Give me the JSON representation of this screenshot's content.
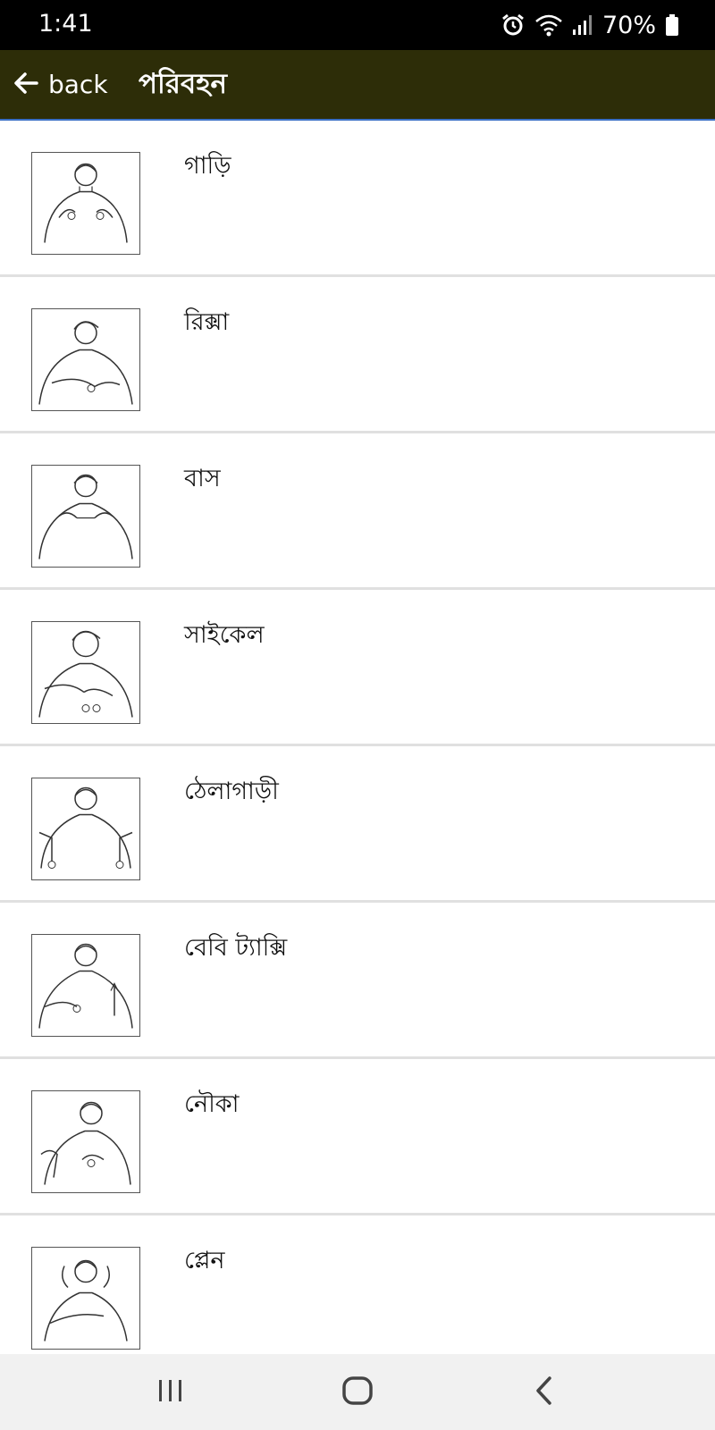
{
  "status": {
    "time": "1:41",
    "battery": "70%"
  },
  "app_bar": {
    "back_label": "back",
    "title": "পরিবহন"
  },
  "items": [
    {
      "label": "গাড়ি"
    },
    {
      "label": "রিক্সা"
    },
    {
      "label": "বাস"
    },
    {
      "label": "সাইকেল"
    },
    {
      "label": "ঠেলাগাড়ী"
    },
    {
      "label": "বেবি ট্যাক্সি"
    },
    {
      "label": "নৌকা"
    },
    {
      "label": "প্লেন"
    }
  ],
  "icons": {
    "back": "arrow-left-icon",
    "alarm": "alarm-icon",
    "wifi": "wifi-icon",
    "signal": "signal-icon",
    "battery": "battery-icon",
    "nav_recent": "recent-apps-icon",
    "nav_home": "home-icon",
    "nav_back": "chevron-left-icon"
  },
  "colors": {
    "app_bar": "#2d2d08",
    "status_bar": "#000000",
    "nav_bar": "#f1f1f1"
  }
}
